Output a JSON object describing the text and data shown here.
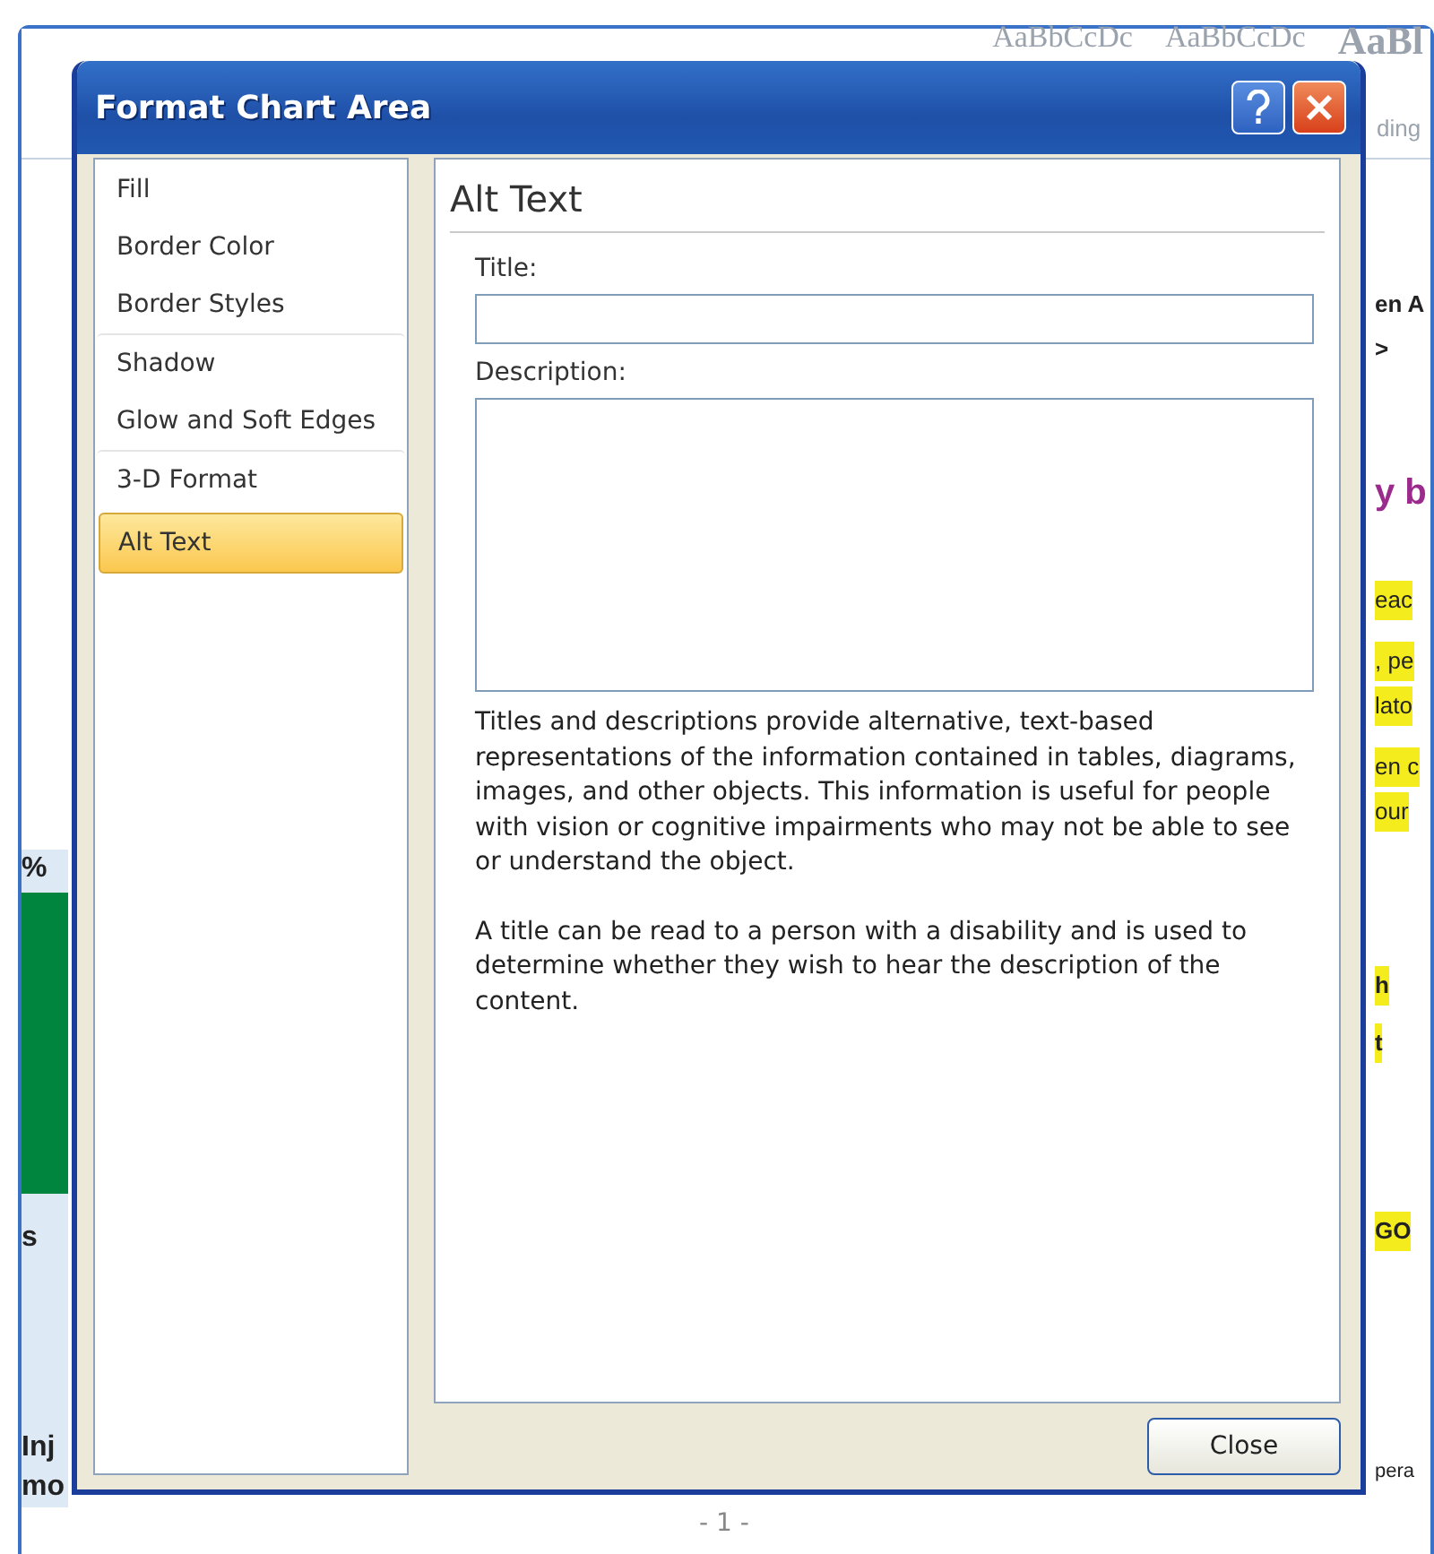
{
  "document": {
    "ribbon_styles": [
      "AaBbCcDc",
      "AaBbCcDc",
      "AaBl"
    ],
    "ribbon_label": "ding",
    "left_fragments": [
      {
        "kind": "text",
        "text": "%"
      },
      {
        "kind": "bar"
      },
      {
        "kind": "text",
        "text": "s"
      },
      {
        "kind": "text",
        "text": "Inj"
      },
      {
        "kind": "text",
        "text": "mo"
      }
    ],
    "right_fragments": [
      {
        "kind": "bold",
        "text": "en A",
        "highlighted": false
      },
      {
        "kind": "bold",
        "text": ">",
        "highlighted": false
      },
      {
        "kind": "heading",
        "text": "y b",
        "highlighted": false
      },
      {
        "kind": "body",
        "text": "eac",
        "highlighted": true
      },
      {
        "kind": "body",
        "text": ", pe",
        "highlighted": true
      },
      {
        "kind": "body",
        "text": "lato",
        "highlighted": true
      },
      {
        "kind": "body",
        "text": "en c",
        "highlighted": true
      },
      {
        "kind": "body",
        "text": "our",
        "highlighted": true
      },
      {
        "kind": "bold",
        "text": "h",
        "highlighted": true
      },
      {
        "kind": "bold",
        "text": "t",
        "highlighted": true
      },
      {
        "kind": "bold",
        "text": "GO",
        "highlighted": true
      },
      {
        "kind": "small",
        "text": "pera",
        "highlighted": false
      }
    ],
    "page_number": "- 1 -"
  },
  "dialog": {
    "title": "Format Chart Area",
    "categories": [
      {
        "label": "Fill",
        "selected": false
      },
      {
        "label": "Border Color",
        "selected": false
      },
      {
        "label": "Border Styles",
        "selected": false
      },
      {
        "label": "Shadow",
        "selected": false
      },
      {
        "label": "Glow and Soft Edges",
        "selected": false
      },
      {
        "label": "3-D Format",
        "selected": false
      },
      {
        "label": "Alt Text",
        "selected": true
      }
    ],
    "panel_title": "Alt Text",
    "title_label": "Title:",
    "description_label": "Description:",
    "help_paragraphs": [
      "Titles and descriptions provide alternative, text-based representations of the information contained in tables, diagrams, images, and other objects. This information is useful for people with vision or cognitive impairments who may not be able to see or understand the object.",
      "A title can be read to a person with a disability and is used to determine whether they wish to hear the description of the content."
    ],
    "close_button": "Close"
  }
}
